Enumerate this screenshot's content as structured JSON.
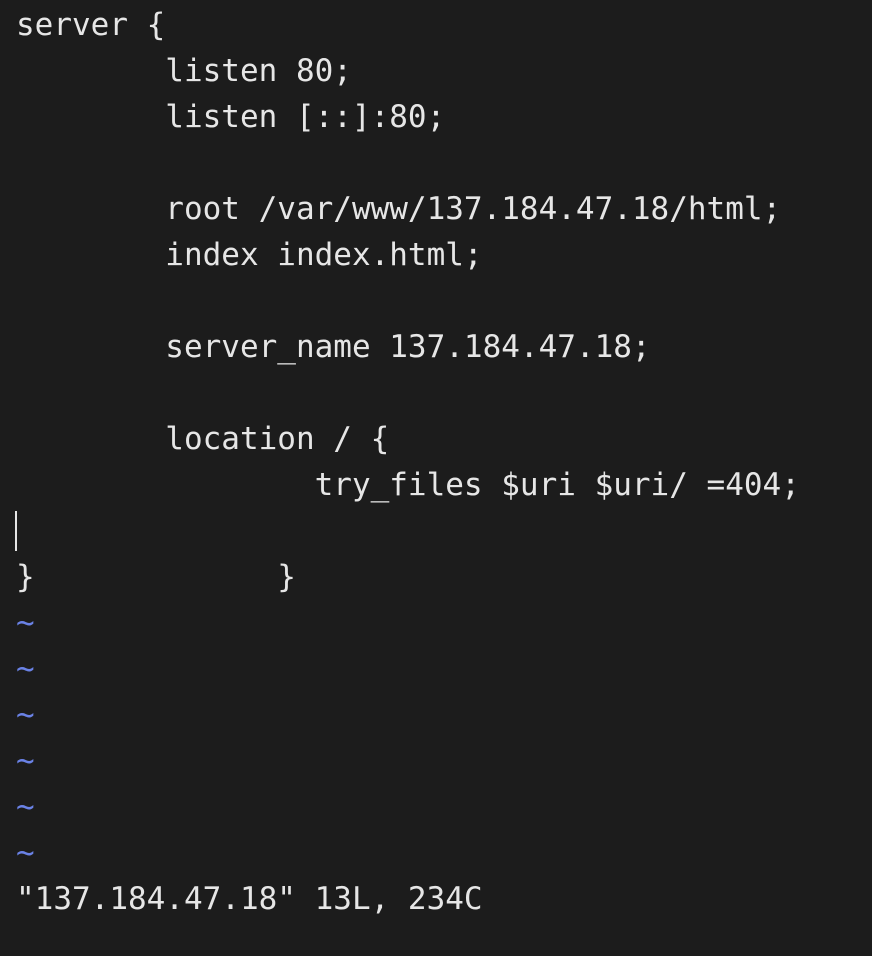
{
  "editor": {
    "lines": [
      "server {",
      "        listen 80;",
      "        listen [::]:80;",
      "",
      "        root /var/www/137.184.47.18/html;",
      "        index index.html;",
      "",
      "        server_name 137.184.47.18;",
      "",
      "        location / {",
      "                try_files $uri $uri/ =404;",
      "        }",
      "}"
    ],
    "empty_line_marker": "~",
    "status_message": "\"137.184.47.18\" 13L, 234C",
    "colors": {
      "background": "#1c1c1c",
      "text": "#e6e6e6",
      "tilde": "#6a82e6"
    }
  }
}
